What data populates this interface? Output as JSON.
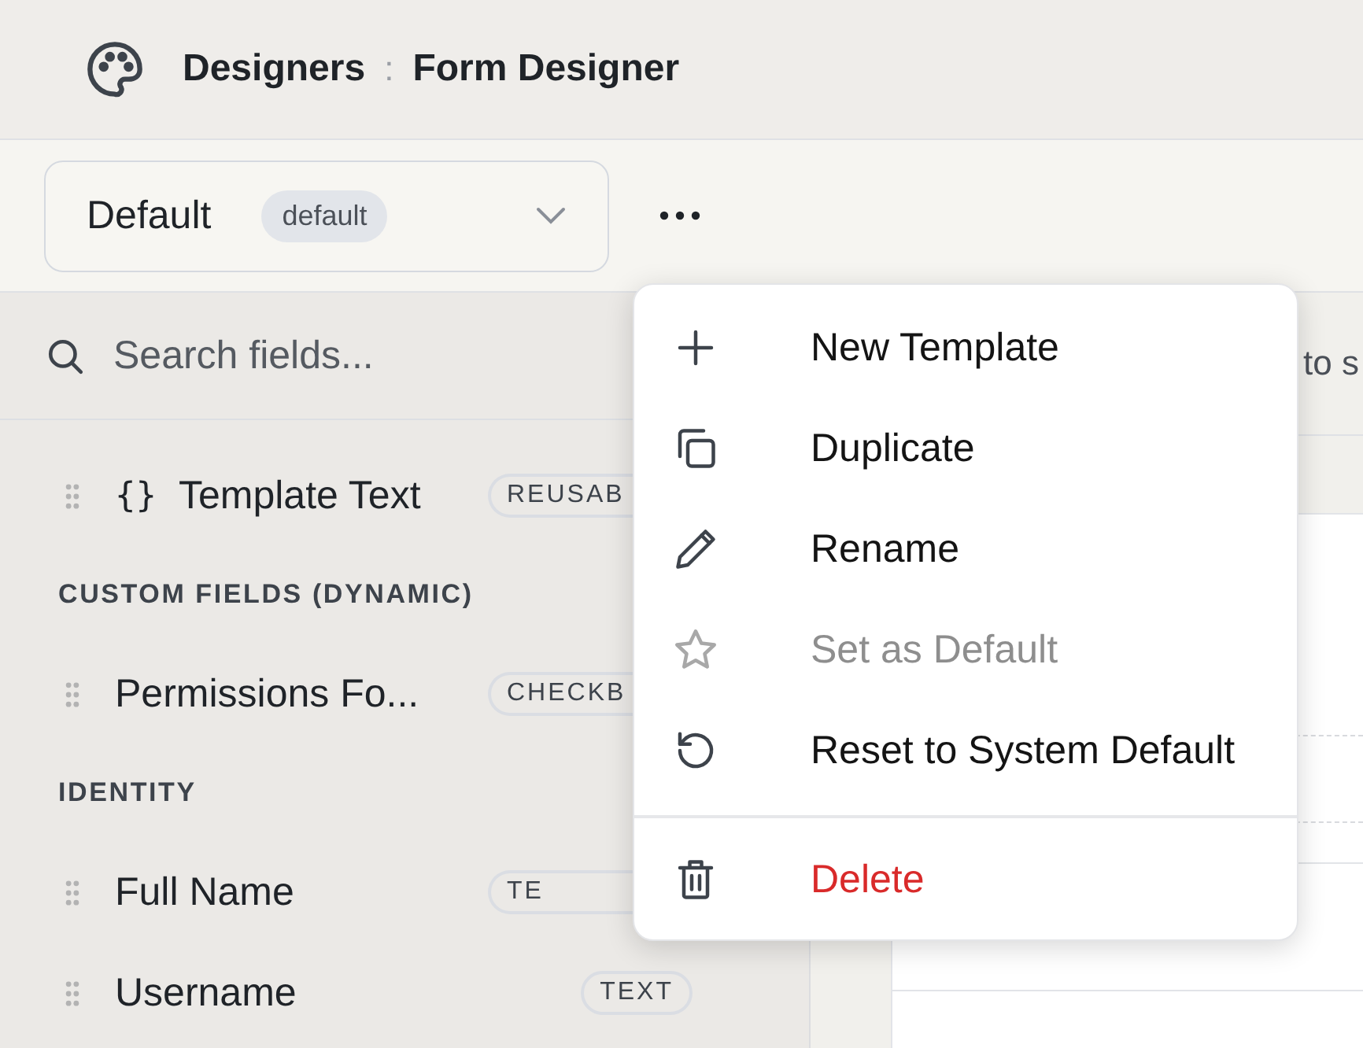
{
  "header": {
    "section": "Designers",
    "separator": ":",
    "page": "Form Designer"
  },
  "toolbar": {
    "template_select": {
      "value": "Default",
      "badge": "default"
    }
  },
  "sidebar": {
    "search": {
      "placeholder": "Search fields..."
    },
    "items": [
      {
        "kind": "field",
        "icon": "{}",
        "label": "Template Text",
        "badge": "REUSAB",
        "clipped": true
      },
      {
        "kind": "heading",
        "label": "CUSTOM FIELDS (DYNAMIC)"
      },
      {
        "kind": "field",
        "label": "Permissions Fo...",
        "badge": "CHECKB",
        "clipped": true
      },
      {
        "kind": "heading",
        "label": "IDENTITY"
      },
      {
        "kind": "field",
        "label": "Full Name",
        "badge": "TE",
        "clipped": true
      },
      {
        "kind": "field",
        "label": "Username",
        "badge": "TEXT",
        "clipped": false
      }
    ]
  },
  "canvas": {
    "hint_fragment": "to s"
  },
  "menu": {
    "items": [
      {
        "kind": "plus",
        "label": "New Template",
        "disabled": false,
        "danger": false
      },
      {
        "kind": "copy",
        "label": "Duplicate",
        "disabled": false,
        "danger": false
      },
      {
        "kind": "pencil",
        "label": "Rename",
        "disabled": false,
        "danger": false
      },
      {
        "kind": "star",
        "label": "Set as Default",
        "disabled": true,
        "danger": false
      },
      {
        "kind": "reset",
        "label": "Reset to System Default",
        "disabled": false,
        "danger": false
      },
      {
        "kind": "trash",
        "label": "Delete",
        "disabled": false,
        "danger": true
      }
    ]
  }
}
